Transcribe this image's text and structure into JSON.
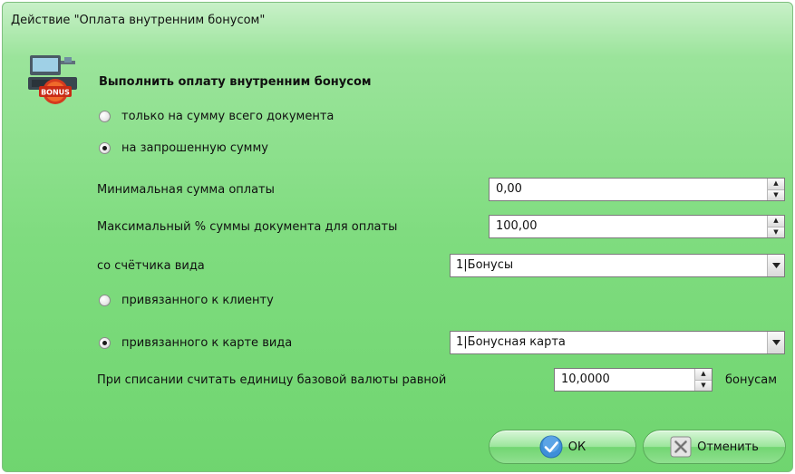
{
  "window": {
    "title": "Действие \"Оплата внутренним бонусом\""
  },
  "header": {
    "icon": "pos-bonus-icon",
    "icon_text": "BONUS",
    "heading": "Выполнить оплату внутренним бонусом"
  },
  "payment_mode": {
    "option_full": "только на сумму всего документа",
    "option_requested": "на запрошенную сумму",
    "selected": "option_requested"
  },
  "min_amount": {
    "label": "Минимальная сумма оплаты",
    "value": "0,00"
  },
  "max_percent": {
    "label": "Максимальный % суммы документа для оплаты",
    "value": "100,00"
  },
  "counter_type": {
    "label": "со счётчика вида",
    "value": "1|Бонусы"
  },
  "binding": {
    "option_client": "привязанного к клиенту",
    "option_card": "привязанного к карте вида",
    "selected": "option_card",
    "card_type_value": "1|Бонусная карта"
  },
  "rate": {
    "label": "При списании считать единицу базовой валюты равной",
    "value": "10,0000",
    "unit": "бонусам"
  },
  "buttons": {
    "ok_label": "ОК",
    "cancel_label": "Отменить"
  },
  "colors": {
    "accent_green": "#7fdc7f",
    "ok_icon_blue": "#3d8fd9"
  }
}
